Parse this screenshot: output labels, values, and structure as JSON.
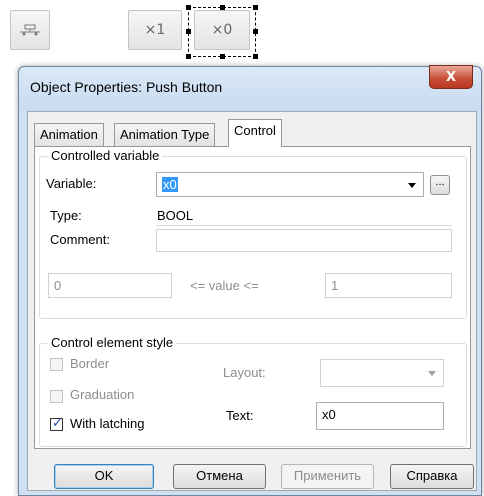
{
  "toolbar": {
    "items": [
      {
        "label": "",
        "icon": "push-button-icon"
      },
      {
        "label": "×1"
      },
      {
        "label": "×0",
        "selected": true
      }
    ]
  },
  "dialog": {
    "title": "Object Properties: Push Button",
    "close_label": "X",
    "tabs": [
      {
        "label": "Animation",
        "active": false
      },
      {
        "label": "Animation Type",
        "active": false
      },
      {
        "label": "Control",
        "active": true
      }
    ],
    "controlled_variable": {
      "legend": "Controlled variable",
      "variable_label": "Variable:",
      "variable_value": "x0",
      "browse_label": "...",
      "type_label": "Type:",
      "type_value": "BOOL",
      "comment_label": "Comment:",
      "comment_value": "",
      "min_value": "0",
      "range_label": "<= value <=",
      "max_value": "1"
    },
    "control_style": {
      "legend": "Control element style",
      "border_label": "Border",
      "border_checked": false,
      "graduation_label": "Graduation",
      "graduation_checked": false,
      "latching_label": "With latching",
      "latching_checked": true,
      "layout_label": "Layout:",
      "layout_value": "",
      "text_label": "Text:",
      "text_value": "x0"
    },
    "buttons": {
      "ok": "OK",
      "cancel": "Отмена",
      "apply": "Применить",
      "help": "Справка"
    }
  },
  "colors": {
    "selection": "#3399ff",
    "title_bar": "#cfe0f3",
    "close_button": "#c9513c"
  }
}
